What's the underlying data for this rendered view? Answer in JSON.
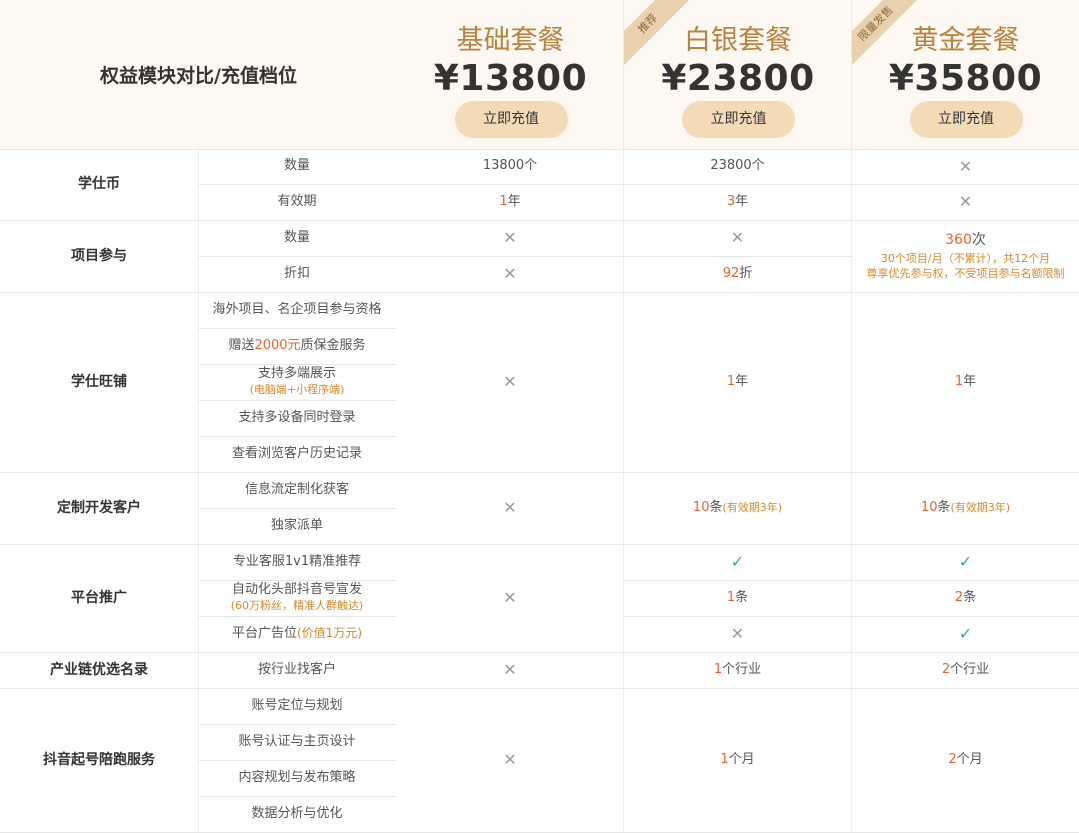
{
  "header": {
    "title": "权益模块对比/充值档位"
  },
  "plans": [
    {
      "name": "基础套餐",
      "price": "¥13800",
      "button": "立即充值",
      "ribbon": ""
    },
    {
      "name": "白银套餐",
      "price": "¥23800",
      "button": "立即充值",
      "ribbon": "推荐"
    },
    {
      "name": "黄金套餐",
      "price": "¥35800",
      "button": "立即充值",
      "ribbon": "限量发售"
    }
  ],
  "categories": {
    "coin": "学仕币",
    "project": "项目参与",
    "shop": "学仕旺铺",
    "custom": "定制开发客户",
    "promo": "平台推广",
    "chain": "产业链优选名录",
    "douyin": "抖音起号陪跑服务"
  },
  "features": {
    "coin_qty": "数量",
    "coin_valid": "有效期",
    "proj_qty": "数量",
    "proj_discount": "折扣",
    "shop_1": "海外项目、名企项目参与资格",
    "shop_2_a": "赠送",
    "shop_2_b": "2000元",
    "shop_2_c": "质保金服务",
    "shop_3": "支持多端展示",
    "shop_3_sub": "(电脑端+小程序端)",
    "shop_4": "支持多设备同时登录",
    "shop_5": "查看浏览客户历史记录",
    "custom_1": "信息流定制化获客",
    "custom_2": "独家派单",
    "promo_1": "专业客服1v1精准推荐",
    "promo_2": "自动化头部抖音号宣发",
    "promo_2_sub": "(60万粉丝，精准人群触达)",
    "promo_3": "平台广告位",
    "promo_3_sub": "(价值1万元)",
    "chain_1": "按行业找客户",
    "douyin_1": "账号定位与规划",
    "douyin_2": "账号认证与主页设计",
    "douyin_3": "内容规划与发布策略",
    "douyin_4": "数据分析与优化"
  },
  "values": {
    "basic_coin_qty": "13800个",
    "basic_valid_num": "1",
    "basic_valid_unit": "年",
    "silver_coin_qty": "23800个",
    "silver_valid_num": "3",
    "silver_valid_unit": "年",
    "silver_discount_num": "92",
    "silver_discount_unit": "折",
    "gold_proj_num": "360",
    "gold_proj_unit": "次",
    "gold_proj_note_1": "30个项目/月（不累计），共12个月",
    "gold_proj_note_2": "尊享优先参与权，不受项目参与名额限制",
    "silver_shop_num": "1",
    "silver_shop_unit": "年",
    "gold_shop_num": "1",
    "gold_shop_unit": "年",
    "silver_custom_num": "10",
    "silver_custom_unit": "条",
    "silver_custom_note": "(有效期3年)",
    "gold_custom_num": "10",
    "gold_custom_unit": "条",
    "gold_custom_note": "(有效期3年)",
    "silver_promo2_num": "1",
    "silver_promo2_unit": "条",
    "gold_promo2_num": "2",
    "gold_promo2_unit": "条",
    "silver_chain_num": "1",
    "silver_chain_unit": "个行业",
    "gold_chain_num": "2",
    "gold_chain_unit": "个行业",
    "silver_douyin_num": "1",
    "silver_douyin_unit": "个月",
    "gold_douyin_num": "2",
    "gold_douyin_unit": "个月"
  },
  "icons": {
    "cross": "cross-icon",
    "check": "check-icon"
  },
  "colors": {
    "accent": "#b9823f",
    "highlight": "#e8652e",
    "check": "#2db77b",
    "header_bg": "#fdf8f1",
    "button_bg": "#f3dbb8"
  }
}
